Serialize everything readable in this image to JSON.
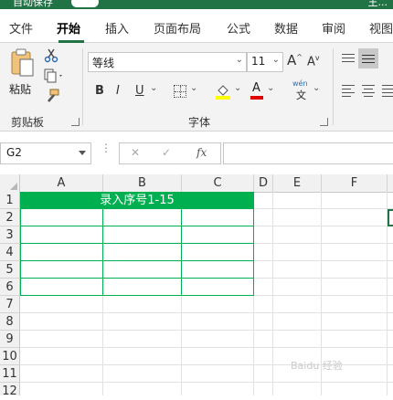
{
  "titlebar": {
    "left_text": "自动保存",
    "right_text": "王..."
  },
  "tabs": [
    {
      "label": "文件"
    },
    {
      "label": "开始"
    },
    {
      "label": "插入"
    },
    {
      "label": "页面布局"
    },
    {
      "label": "公式"
    },
    {
      "label": "数据"
    },
    {
      "label": "审阅"
    },
    {
      "label": "视图"
    }
  ],
  "ribbon": {
    "paste_label": "粘贴",
    "clipboard_group": "剪贴板",
    "font_name": "等线",
    "font_size": "11",
    "grow_font": "A",
    "shrink_font": "A",
    "bold": "B",
    "italic": "I",
    "underline": "U",
    "font_color_letter": "A",
    "phonetic_top": "wén",
    "phonetic_bottom": "文",
    "font_group": "字体"
  },
  "formula_bar": {
    "name_box": "G2",
    "cancel": "✕",
    "confirm": "✓",
    "fx": "fx",
    "content": ""
  },
  "sheet": {
    "columns": [
      "A",
      "B",
      "C",
      "D",
      "E",
      "F"
    ],
    "rows": [
      "1",
      "2",
      "3",
      "4",
      "5",
      "6",
      "7",
      "8",
      "9",
      "10",
      "11",
      "12"
    ],
    "merged_title": "录入序号1-15",
    "header_fill": "#00b050",
    "border_color": "#00b050",
    "selected_cell": "G2"
  },
  "watermark": "Baidu 经验"
}
